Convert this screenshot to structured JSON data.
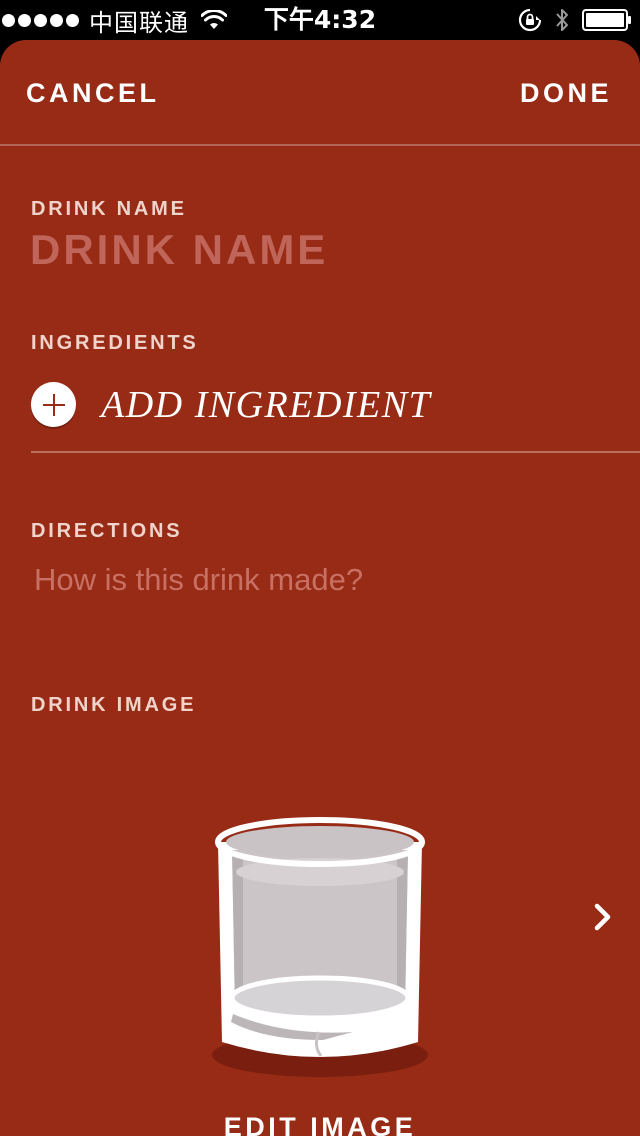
{
  "status_bar": {
    "carrier": "中国联通",
    "time": "下午4:32",
    "icons": [
      "signal-dots-icon",
      "wifi-icon",
      "rotation-lock-icon",
      "bluetooth-icon",
      "battery-icon"
    ]
  },
  "nav": {
    "cancel_label": "CANCEL",
    "done_label": "DONE"
  },
  "form": {
    "drink_name_label": "DRINK NAME",
    "drink_name_value": "",
    "drink_name_placeholder": "DRINK NAME",
    "ingredients_label": "INGREDIENTS",
    "add_ingredient_label": "ADD INGREDIENT",
    "directions_label": "DIRECTIONS",
    "directions_value": "",
    "directions_placeholder": "How is this drink made?",
    "drink_image_label": "DRINK IMAGE",
    "edit_image_label": "EDIT IMAGE"
  },
  "colors": {
    "background": "#982b16",
    "label": "#f0d4cc",
    "placeholder": "#c0655a",
    "text": "#ffffff"
  }
}
